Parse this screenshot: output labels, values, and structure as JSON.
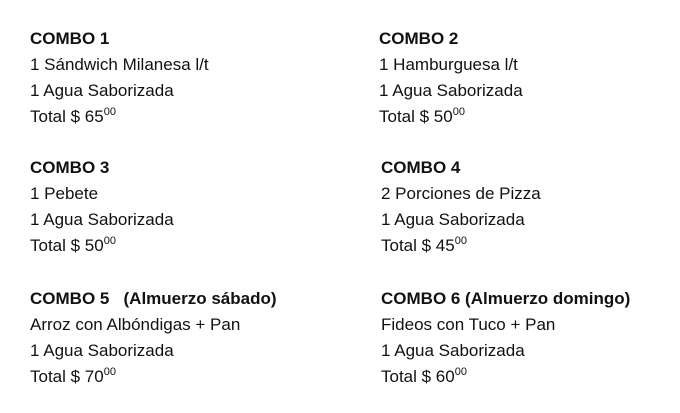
{
  "combos": [
    {
      "title": "COMBO 1",
      "items": [
        "1 Sándwich Milanesa l/t",
        "1 Agua Saborizada"
      ],
      "total_label": "Total $ 65",
      "total_cents": "00"
    },
    {
      "title": "COMBO 2",
      "items": [
        "1 Hamburguesa l/t",
        "1 Agua Saborizada"
      ],
      "total_label": "Total $ 50",
      "total_cents": "00"
    },
    {
      "title": "COMBO 3",
      "items": [
        "1 Pebete",
        "1 Agua Saborizada"
      ],
      "total_label": "Total $ 50",
      "total_cents": "00"
    },
    {
      "title": "COMBO 4",
      "items": [
        "2 Porciones de Pizza",
        "1 Agua Saborizada"
      ],
      "total_label": "Total $ 45",
      "total_cents": "00"
    },
    {
      "title": "COMBO 5   (Almuerzo sábado)",
      "items": [
        "Arroz con Albóndigas + Pan",
        "1 Agua Saborizada"
      ],
      "total_label": "Total $ 70",
      "total_cents": "00"
    },
    {
      "title": "COMBO 6 (Almuerzo domingo)",
      "items": [
        "Fideos con Tuco + Pan",
        "1 Agua Saborizada"
      ],
      "total_label": "Total $ 60",
      "total_cents": "00"
    }
  ]
}
